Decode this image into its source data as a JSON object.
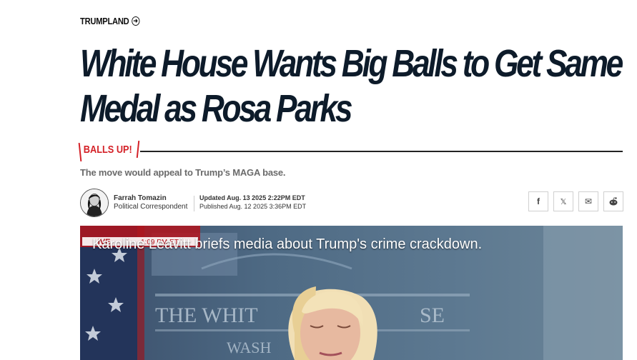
{
  "section": {
    "label": "TRUMPLAND",
    "icon": "arrow-circle-right-icon"
  },
  "headline": "White House Wants Big Balls to Get Same Medal as Rosa Parks",
  "kicker": "BALLS UP!",
  "dek": "The move would appeal to Trump’s MAGA base.",
  "author": {
    "name": "Farrah Tomazin",
    "role": "Political Correspondent"
  },
  "dates": {
    "updated": "Updated Aug. 13 2025 2:22PM EDT",
    "published": "Published Aug. 12 2025 3:36PM EDT"
  },
  "share": [
    {
      "icon": "facebook-icon",
      "glyph": "f"
    },
    {
      "icon": "x-icon",
      "glyph": "𝕏"
    },
    {
      "icon": "email-icon",
      "glyph": "✉"
    },
    {
      "icon": "reddit-icon",
      "glyph": "●"
    }
  ],
  "video": {
    "caption": "Karoline Leavitt briefs media about Trump's crime crackdown.",
    "live_label": "LIVE",
    "live_time": "1:09 PM ET",
    "backdrop_text_1": "THE WHIT",
    "backdrop_text_2": "SE",
    "backdrop_text_3": "WASH"
  },
  "colors": {
    "accent": "#d42127",
    "headline": "#0d1b2a",
    "dek": "#6b6b6b"
  }
}
